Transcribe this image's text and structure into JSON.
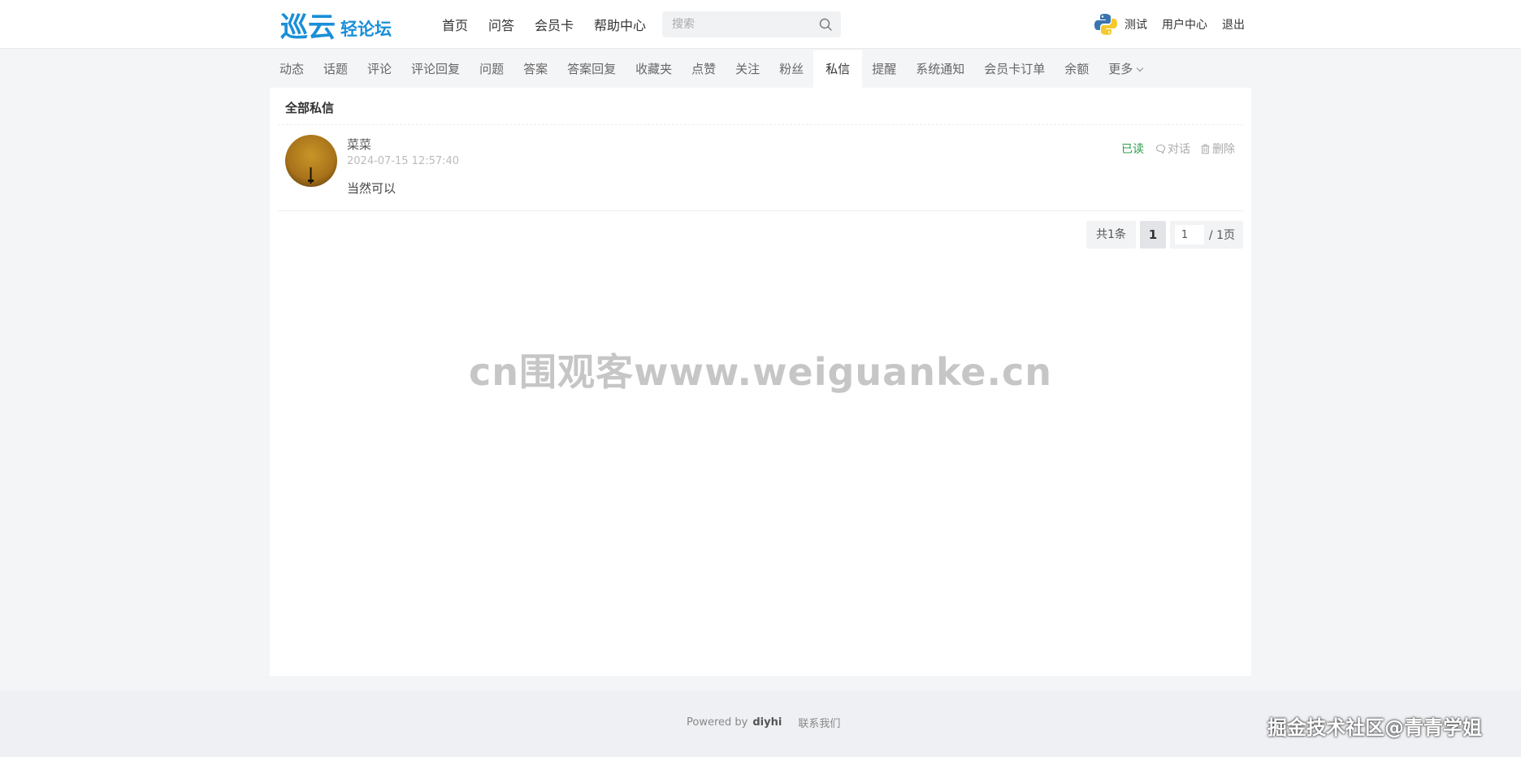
{
  "header": {
    "logo_main": "巡云",
    "logo_sub": "轻论坛",
    "nav": [
      "首页",
      "问答",
      "会员卡",
      "帮助中心"
    ],
    "search_placeholder": "搜索",
    "username": "测试",
    "user_center": "用户中心",
    "logout": "退出"
  },
  "subnav": {
    "tabs": [
      "动态",
      "话题",
      "评论",
      "评论回复",
      "问题",
      "答案",
      "答案回复",
      "收藏夹",
      "点赞",
      "关注",
      "粉丝",
      "私信",
      "提醒",
      "系统通知",
      "会员卡订单",
      "余额",
      "更多"
    ],
    "active": "私信"
  },
  "panel": {
    "title": "全部私信",
    "message": {
      "sender": "菜菜",
      "time": "2024-07-15 12:57:40",
      "body": "当然可以",
      "status": "已读",
      "action_chat": "对话",
      "action_delete": "删除"
    },
    "pager": {
      "total": "共1条",
      "current": "1",
      "jump_value": "1",
      "pages": "/ 1页"
    }
  },
  "watermark": "cn围观客www.weiguanke.cn",
  "footer": {
    "powered_prefix": "Powered by",
    "powered_brand": "diyhi",
    "contact": "联系我们"
  },
  "corner_watermark": "掘金技术社区@青青学姐",
  "colors": {
    "brand": "#1a8fd8",
    "read_status": "#2a9c4a",
    "page_bg": "#f4f5f7"
  }
}
